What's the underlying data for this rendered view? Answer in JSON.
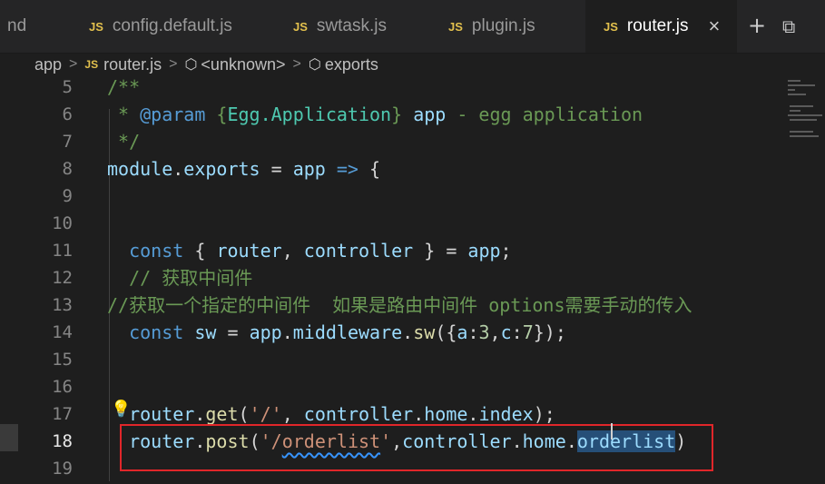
{
  "tabs": [
    {
      "label": "nd",
      "icon": "",
      "active": false
    },
    {
      "label": "config.default.js",
      "icon": "JS",
      "active": false
    },
    {
      "label": "swtask.js",
      "icon": "JS",
      "active": false
    },
    {
      "label": "plugin.js",
      "icon": "JS",
      "active": false
    },
    {
      "label": "router.js",
      "icon": "JS",
      "active": true
    }
  ],
  "tab_close_icon": "×",
  "tab_actions": {
    "add": "+",
    "split": "⧉"
  },
  "breadcrumb": {
    "items": [
      "app",
      "router.js",
      "<unknown>",
      "exports"
    ],
    "separator": ">",
    "js_icon": "JS",
    "symbol_icon": "⬡"
  },
  "editor": {
    "line_numbers": [
      "5",
      "6",
      "7",
      "8",
      "9",
      "10",
      "11",
      "12",
      "13",
      "14",
      "15",
      "16",
      "17",
      "18",
      "19"
    ],
    "active_line": "18",
    "lines": [
      [
        {
          "t": "/**",
          "c": "comment"
        }
      ],
      [
        {
          "t": " * ",
          "c": "comment"
        },
        {
          "t": "@param",
          "c": "tag"
        },
        {
          "t": " {",
          "c": "comment"
        },
        {
          "t": "Egg.Application",
          "c": "type"
        },
        {
          "t": "} ",
          "c": "comment"
        },
        {
          "t": "app",
          "c": "var"
        },
        {
          "t": " - egg application",
          "c": "comment"
        }
      ],
      [
        {
          "t": " */",
          "c": "comment"
        }
      ],
      [
        {
          "t": "module",
          "c": "var"
        },
        {
          "t": ".",
          "c": "plain"
        },
        {
          "t": "exports",
          "c": "var"
        },
        {
          "t": " = ",
          "c": "plain"
        },
        {
          "t": "app",
          "c": "var"
        },
        {
          "t": " ",
          "c": "plain"
        },
        {
          "t": "=>",
          "c": "kw"
        },
        {
          "t": " {",
          "c": "plain"
        }
      ],
      [],
      [],
      [
        {
          "t": "  ",
          "c": "plain"
        },
        {
          "t": "const",
          "c": "kw"
        },
        {
          "t": " { ",
          "c": "plain"
        },
        {
          "t": "router",
          "c": "var"
        },
        {
          "t": ", ",
          "c": "plain"
        },
        {
          "t": "controller",
          "c": "var"
        },
        {
          "t": " } = ",
          "c": "plain"
        },
        {
          "t": "app",
          "c": "var"
        },
        {
          "t": ";",
          "c": "plain"
        }
      ],
      [
        {
          "t": "  // 获取中间件",
          "c": "comment"
        }
      ],
      [
        {
          "t": "//获取一个指定的中间件  如果是路由中间件 options需要手动的传入",
          "c": "comment"
        }
      ],
      [
        {
          "t": "  ",
          "c": "plain"
        },
        {
          "t": "const",
          "c": "kw"
        },
        {
          "t": " ",
          "c": "plain"
        },
        {
          "t": "sw",
          "c": "var"
        },
        {
          "t": " = ",
          "c": "plain"
        },
        {
          "t": "app",
          "c": "var"
        },
        {
          "t": ".",
          "c": "plain"
        },
        {
          "t": "middleware",
          "c": "var"
        },
        {
          "t": ".",
          "c": "plain"
        },
        {
          "t": "sw",
          "c": "fn"
        },
        {
          "t": "({",
          "c": "plain"
        },
        {
          "t": "a",
          "c": "var"
        },
        {
          "t": ":",
          "c": "plain"
        },
        {
          "t": "3",
          "c": "num"
        },
        {
          "t": ",",
          "c": "plain"
        },
        {
          "t": "c",
          "c": "var"
        },
        {
          "t": ":",
          "c": "plain"
        },
        {
          "t": "7",
          "c": "num"
        },
        {
          "t": "});",
          "c": "plain"
        }
      ],
      [],
      [],
      [
        {
          "t": "  ",
          "c": "plain"
        },
        {
          "t": "router",
          "c": "var"
        },
        {
          "t": ".",
          "c": "plain"
        },
        {
          "t": "get",
          "c": "fn"
        },
        {
          "t": "(",
          "c": "plain"
        },
        {
          "t": "'/'",
          "c": "str"
        },
        {
          "t": ", ",
          "c": "plain"
        },
        {
          "t": "controller",
          "c": "var"
        },
        {
          "t": ".",
          "c": "plain"
        },
        {
          "t": "home",
          "c": "var"
        },
        {
          "t": ".",
          "c": "plain"
        },
        {
          "t": "index",
          "c": "var"
        },
        {
          "t": ");",
          "c": "plain"
        }
      ],
      [
        {
          "t": "  ",
          "c": "plain"
        },
        {
          "t": "router",
          "c": "var"
        },
        {
          "t": ".",
          "c": "plain"
        },
        {
          "t": "post",
          "c": "fn"
        },
        {
          "t": "(",
          "c": "plain"
        },
        {
          "t": "'/",
          "c": "str"
        },
        {
          "t": "orderlist",
          "c": "str",
          "squiggle": true
        },
        {
          "t": "'",
          "c": "str"
        },
        {
          "t": ",",
          "c": "plain"
        },
        {
          "t": "controller",
          "c": "var"
        },
        {
          "t": ".",
          "c": "plain"
        },
        {
          "t": "home",
          "c": "var"
        },
        {
          "t": ".",
          "c": "plain"
        },
        {
          "t": "orderlist",
          "c": "var",
          "selected": true
        },
        {
          "t": ")",
          "c": "plain"
        }
      ],
      []
    ]
  },
  "colors": {
    "comment": "#6a9955",
    "keyword": "#569cd6",
    "variable": "#9cdcfe",
    "string": "#ce9178",
    "function": "#dcdcaa",
    "number": "#b5cea8",
    "highlight_box": "#e0262a"
  }
}
